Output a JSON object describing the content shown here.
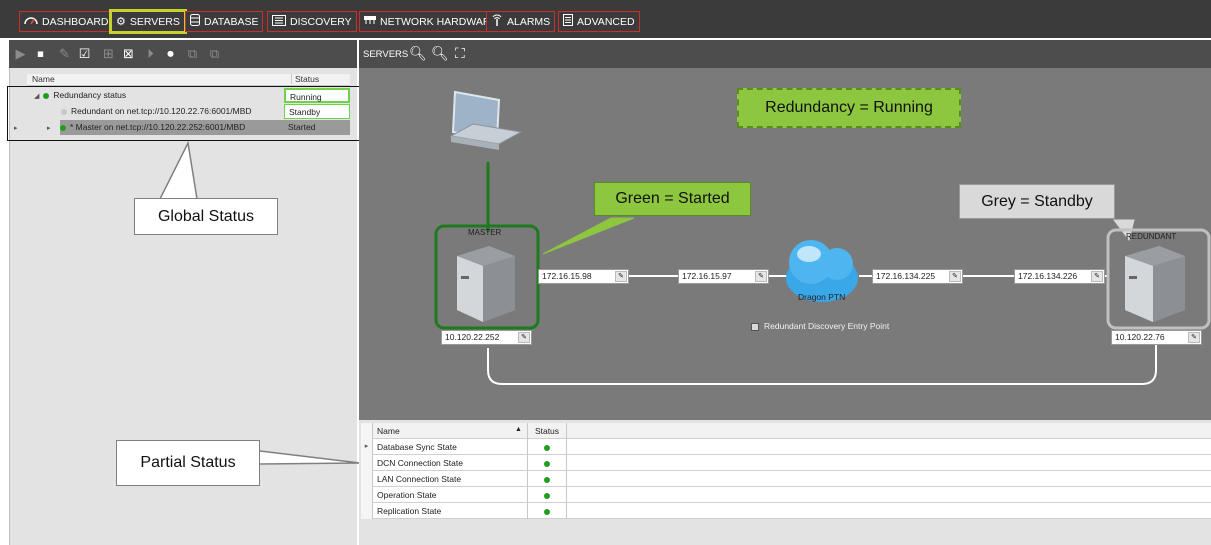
{
  "nav": [
    {
      "label": "DASHBOARD",
      "icon": "dashboard-icon",
      "active": false
    },
    {
      "label": "SERVERS",
      "icon": "gear-icon",
      "active": true
    },
    {
      "label": "DATABASE",
      "icon": "database-icon",
      "active": false
    },
    {
      "label": "DISCOVERY",
      "icon": "discovery-icon",
      "active": false
    },
    {
      "label": "NETWORK HARDWARE",
      "icon": "network-icon",
      "active": false
    },
    {
      "label": "ALARMS",
      "icon": "alarm-icon",
      "active": false
    },
    {
      "label": "ADVANCED",
      "icon": "document-icon",
      "active": false
    }
  ],
  "left_tree": {
    "columns": {
      "name": "Name",
      "status": "Status"
    },
    "rows": [
      {
        "name": "Redundancy status",
        "status": "Running",
        "dot": "#1f9d1f"
      },
      {
        "name": "Redundant on net.tcp://10.120.22.76:6001/MBD",
        "status": "Standby",
        "dot": "#c8c8c8"
      },
      {
        "name": "* Master on net.tcp://10.120.22.252:6001/MBD",
        "status": "Started",
        "dot": "#1f9d1f"
      }
    ]
  },
  "callouts": {
    "global_status": "Global Status",
    "partial_status": "Partial Status",
    "green_started": "Green = Started",
    "grey_standby": "Grey = Standby",
    "redundancy_running": "Redundancy = Running"
  },
  "diagram": {
    "toolbar_label": "SERVERS",
    "master_label": "MASTER",
    "redundant_label": "REDUNDANT",
    "cloud_label": "Dragon PTN",
    "checkbox_label": "Redundant Discovery Entry Point",
    "ips": {
      "master_mgmt": "10.120.22.252",
      "master_link": "172.16.15.98",
      "cloud_left": "172.16.15.97",
      "cloud_right": "172.16.134.225",
      "redundant_link": "172.16.134.226",
      "redundant_mgmt": "10.120.22.76"
    }
  },
  "bottom_table": {
    "columns": {
      "name": "Name",
      "status": "Status"
    },
    "rows": [
      {
        "name": "Database Sync State"
      },
      {
        "name": "DCN Connection State"
      },
      {
        "name": "LAN Connection State"
      },
      {
        "name": "Operation State"
      },
      {
        "name": "Replication State"
      }
    ]
  },
  "colors": {
    "started": "#1f9d1f",
    "standby": "#c8c8c8",
    "callout_green": "#8dc63f",
    "accent_active": "#c8d12e"
  }
}
